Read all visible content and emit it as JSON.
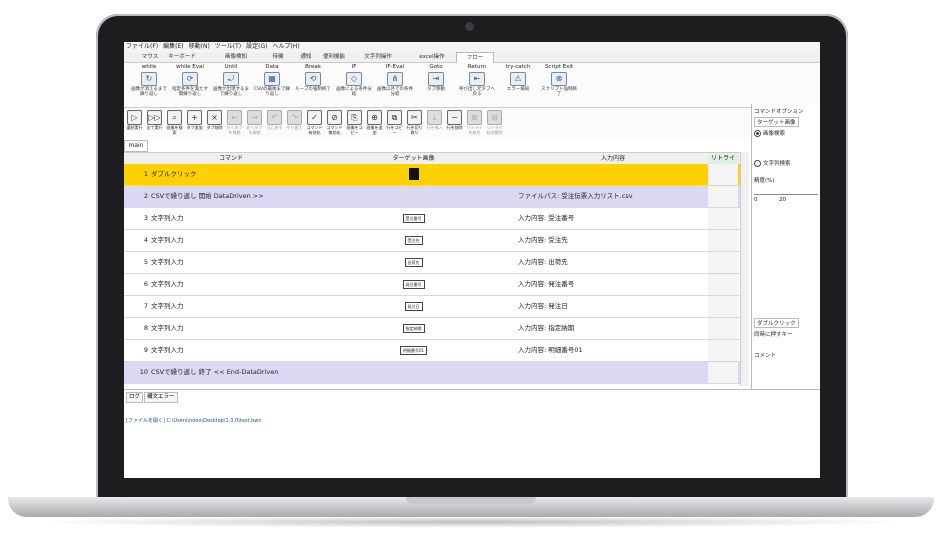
{
  "menu": [
    "ファイル(F)",
    "編集(E)",
    "移動(N)",
    "ツール(T)",
    "設定(G)",
    "ヘルプ(H)"
  ],
  "tabs": [
    {
      "label": "マウス",
      "active": false
    },
    {
      "label": "キーボード",
      "active": false
    },
    {
      "label": "画像検知",
      "active": false
    },
    {
      "label": "待機",
      "active": false
    },
    {
      "label": "通知",
      "active": false
    },
    {
      "label": "便利機能",
      "active": false
    },
    {
      "label": "文字列操作",
      "active": false
    },
    {
      "label": "excel操作",
      "active": false
    },
    {
      "label": "フロー",
      "active": true
    }
  ],
  "ribbon": [
    {
      "title": "while",
      "icon": "loop-icon",
      "desc": "画像が消えるまで繰り返し"
    },
    {
      "title": "while Eval",
      "icon": "loop-eval-icon",
      "desc": "指定条件を満たす間繰り返し"
    },
    {
      "title": "Until",
      "icon": "until-icon",
      "desc": "画像が出現するまで繰り返し"
    },
    {
      "title": "Data",
      "icon": "csv-icon",
      "desc": "CSVの最後まで繰り返し"
    },
    {
      "title": "Break",
      "icon": "break-icon",
      "desc": "ループの強制終了"
    },
    {
      "title": "IF",
      "icon": "if-icon",
      "desc": "画像による条件分岐"
    },
    {
      "title": "IF-Eval",
      "icon": "if-eval-icon",
      "desc": "画像以外での条件分岐"
    },
    {
      "title": "Goto",
      "icon": "goto-icon",
      "desc": "タブ移動"
    },
    {
      "title": "Return",
      "icon": "return-icon",
      "desc": "呼び出し元タブへ戻る"
    },
    {
      "title": "try-catch",
      "icon": "warning-icon",
      "desc": "エラー検知"
    },
    {
      "title": "Script Exit",
      "icon": "exit-icon",
      "desc": "スクリプト強制終了"
    }
  ],
  "toolbar": [
    {
      "label": "選択実行",
      "icon": "play-icon",
      "enabled": true
    },
    {
      "label": "全て実行",
      "icon": "play-all-icon",
      "enabled": true
    },
    {
      "label": "画像を検索",
      "icon": "image-search-icon",
      "enabled": true
    },
    {
      "label": "タブ追加",
      "icon": "tab-add-icon",
      "enabled": true
    },
    {
      "label": "タブ削除",
      "icon": "tab-delete-icon",
      "enabled": true
    },
    {
      "label": "左へタブを移動",
      "icon": "tab-left-icon",
      "enabled": false
    },
    {
      "label": "右へタブを移動",
      "icon": "tab-right-icon",
      "enabled": false
    },
    {
      "label": "元に戻す",
      "icon": "undo-icon",
      "enabled": false
    },
    {
      "label": "やり直す",
      "icon": "redo-icon",
      "enabled": false
    },
    {
      "label": "コマンド有効化",
      "icon": "enable-icon",
      "enabled": true
    },
    {
      "label": "コマンド無効化",
      "icon": "disable-icon",
      "enabled": true
    },
    {
      "label": "画像をコピー",
      "icon": "image-copy-icon",
      "enabled": true
    },
    {
      "label": "画像を追加",
      "icon": "image-add-icon",
      "enabled": true
    },
    {
      "label": "行をコピー",
      "icon": "row-copy-icon",
      "enabled": true
    },
    {
      "label": "行を切り取り",
      "icon": "row-cut-icon",
      "enabled": true
    },
    {
      "label": "行を挿入",
      "icon": "row-insert-icon",
      "enabled": false
    },
    {
      "label": "行を削除",
      "icon": "row-delete-icon",
      "enabled": true
    },
    {
      "label": "リトライを結合",
      "icon": "retry-join-icon",
      "enabled": false
    },
    {
      "label": "リトライ結合解除",
      "icon": "retry-split-icon",
      "enabled": false
    }
  ],
  "main_tab": "main",
  "grid": {
    "headers": {
      "command": "コマンド",
      "target": "ターゲット画像",
      "input": "入力内容",
      "retry": "リトライ"
    },
    "rows": [
      {
        "n": "1",
        "command": "ダブルクリック",
        "target": "black",
        "target_text": "",
        "input": "",
        "style": "sel"
      },
      {
        "n": "2",
        "command": "CSVで繰り返し 開始 DataDriven >>",
        "target": "",
        "target_text": "",
        "input": "ファイルパス: 受注伝票入力リスト.csv",
        "style": "loop"
      },
      {
        "n": "3",
        "command": "文字列入力",
        "target": "thumb",
        "target_text": "受注番号",
        "input": "入力内容: 受注番号",
        "style": ""
      },
      {
        "n": "4",
        "command": "文字列入力",
        "target": "thumb",
        "target_text": "受注先",
        "input": "入力内容: 受注先",
        "style": ""
      },
      {
        "n": "5",
        "command": "文字列入力",
        "target": "thumb",
        "target_text": "出荷先",
        "input": "入力内容: 出荷先",
        "style": ""
      },
      {
        "n": "6",
        "command": "文字列入力",
        "target": "thumb",
        "target_text": "発注番号",
        "input": "入力内容: 発注番号",
        "style": ""
      },
      {
        "n": "7",
        "command": "文字列入力",
        "target": "thumb",
        "target_text": "発注日",
        "input": "入力内容: 発注日",
        "style": ""
      },
      {
        "n": "8",
        "command": "文字列入力",
        "target": "thumb",
        "target_text": "指定納期",
        "input": "入力内容: 指定納期",
        "style": ""
      },
      {
        "n": "9",
        "command": "文字列入力",
        "target": "thumb",
        "target_text": "明細番号01",
        "input": "入力内容: 明細番号01",
        "style": ""
      },
      {
        "n": "10",
        "command": "CSVで繰り返し 終了 << End-DataDriven",
        "target": "",
        "target_text": "",
        "input": "",
        "style": "loop"
      }
    ]
  },
  "side": {
    "title": "コマンドオプション",
    "subtab": "ターゲット画像",
    "radio_image": "画像検索",
    "radio_text": "文字列検索",
    "accuracy": "精度(%)",
    "scale_0": "0",
    "scale_20": "20",
    "section": "ダブルクリック",
    "sync_key": "同時に押すキー",
    "comment": "コメント"
  },
  "log": {
    "tab1": "ログ",
    "tab2": "構文エラー",
    "line": "[ファイルを開く] C:\\Users\\nono\\Desktop\\1.3.0\\test.bwn"
  }
}
